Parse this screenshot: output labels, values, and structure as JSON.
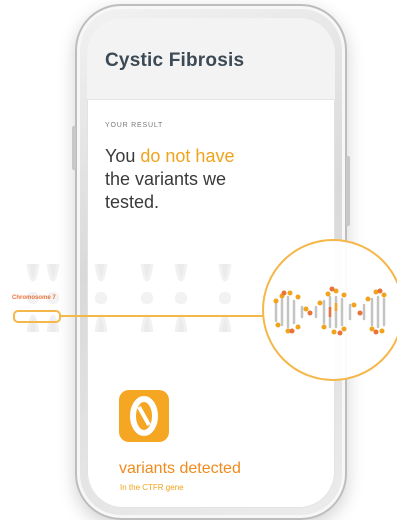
{
  "screen": {
    "title": "Cystic Fibrosis",
    "result_label": "YOUR RESULT",
    "headline": {
      "prefix": "You ",
      "highlight": "do not have",
      "line2": "the variants we",
      "line3": "tested."
    },
    "count": {
      "icon": "zero-digit-icon",
      "value": 0,
      "label": "variants detected",
      "sublabel": "In the CTFR gene"
    }
  },
  "diagram": {
    "chromosome_label": "Chromosome 7",
    "icons": [
      "chromosome-icon",
      "dna-helix-icon"
    ]
  },
  "colors": {
    "accent_orange": "#f0a31c",
    "accent_deep": "#f08a1c",
    "accent_red": "#e8723a",
    "title": "#3c4a55",
    "outline": "#f5b74a",
    "dna_gray": "#b9b9b9"
  }
}
